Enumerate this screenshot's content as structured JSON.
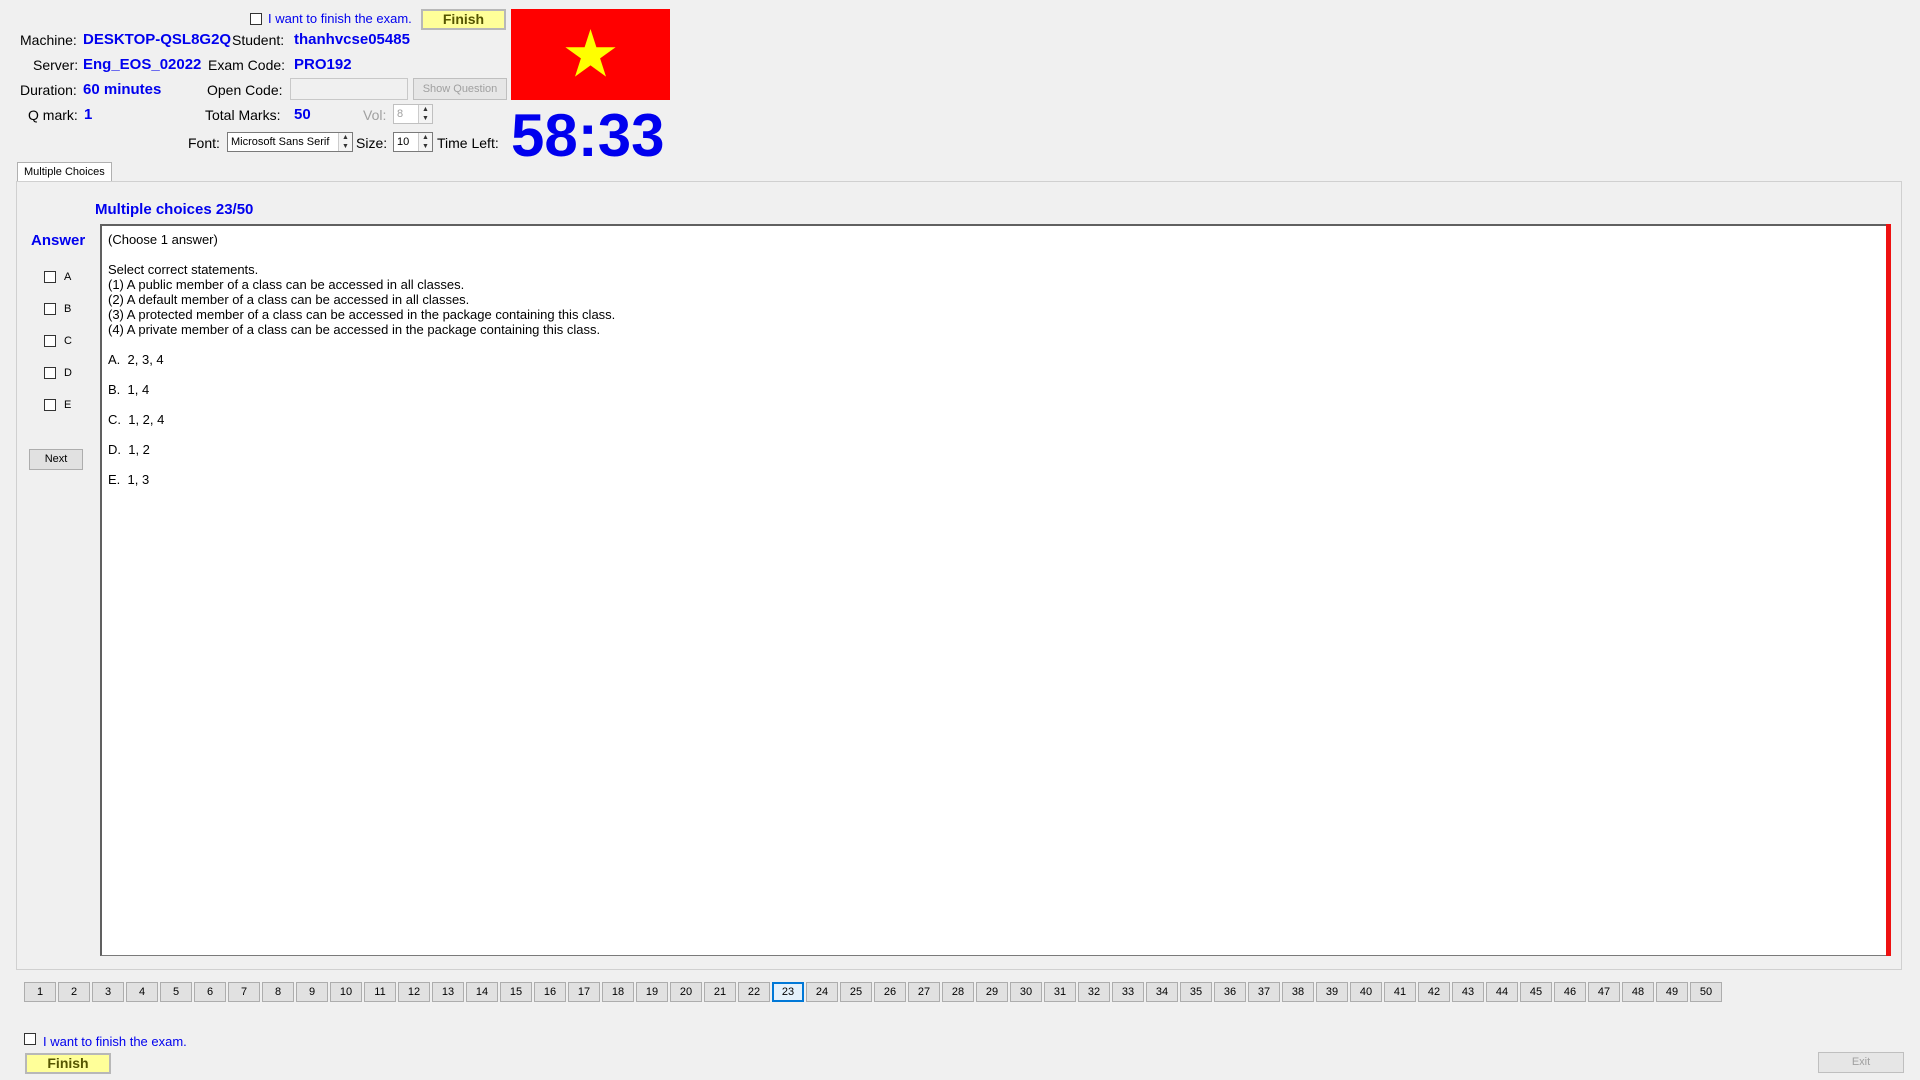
{
  "header": {
    "finish_check_label": "I want to finish the exam.",
    "finish_button_label": "Finish",
    "machine_label": "Machine:",
    "machine_value": "DESKTOP-QSL8G2Q",
    "student_label": "Student:",
    "student_value": "thanhvcse05485",
    "server_label": "Server:",
    "server_value": "Eng_EOS_02022",
    "exam_code_label": "Exam Code:",
    "exam_code_value": "PRO192",
    "duration_label": "Duration:",
    "duration_value": "60 minutes",
    "open_code_label": "Open Code:",
    "open_code_value": "",
    "show_question_label": "Show Question",
    "qmark_label": "Q mark:",
    "qmark_value": "1",
    "total_marks_label": "Total Marks:",
    "total_marks_value": "50",
    "vol_label": "Vol:",
    "vol_value": "8",
    "font_label": "Font:",
    "font_value": "Microsoft Sans Serif",
    "size_label": "Size:",
    "size_value": "10",
    "time_left_label": "Time Left:",
    "timer_value": "58:33",
    "flag_colors": {
      "background": "#ff0000",
      "star": "#ffff00"
    }
  },
  "tab": {
    "label": "Multiple Choices"
  },
  "question": {
    "title": "Multiple choices 23/50",
    "answer_title": "Answer",
    "options": [
      "A",
      "B",
      "C",
      "D",
      "E"
    ],
    "next_label": "Next",
    "text": "(Choose 1 answer)\n\nSelect correct statements.\n(1) A public member of a class can be accessed in all classes.\n(2) A default member of a class can be accessed in all classes.\n(3) A protected member of a class can be accessed in the package containing this class.\n(4) A private member of a class can be accessed in the package containing this class.\n\nA.  2, 3, 4\n\nB.  1, 4\n\nC.  1, 2, 4\n\nD.  1, 2\n\nE.  1, 3"
  },
  "navigation": {
    "buttons": [
      "1",
      "2",
      "3",
      "4",
      "5",
      "6",
      "7",
      "8",
      "9",
      "10",
      "11",
      "12",
      "13",
      "14",
      "15",
      "16",
      "17",
      "18",
      "19",
      "20",
      "21",
      "22",
      "23",
      "24",
      "25",
      "26",
      "27",
      "28",
      "29",
      "30",
      "31",
      "32",
      "33",
      "34",
      "35",
      "36",
      "37",
      "38",
      "39",
      "40",
      "41",
      "42",
      "43",
      "44",
      "45",
      "46",
      "47",
      "48",
      "49",
      "50"
    ],
    "current": "23"
  },
  "footer": {
    "finish_check_label": "I want to finish the exam.",
    "finish_button_label": "Finish",
    "exit_label": "Exit"
  }
}
